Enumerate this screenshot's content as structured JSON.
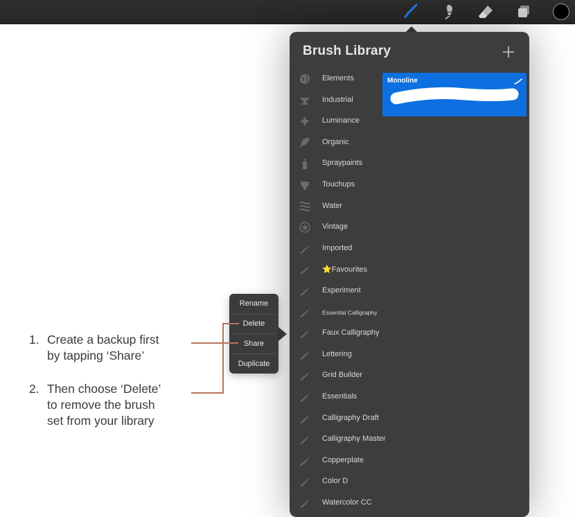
{
  "toolbar": {
    "tools": [
      "brush-icon",
      "smudge-icon",
      "eraser-icon",
      "layers-icon"
    ],
    "active_tool": "brush-icon",
    "active_color": "#000000",
    "accent": "#1f7ef0"
  },
  "brush_library": {
    "title": "Brush Library",
    "add_icon": "plus-icon",
    "sets": [
      {
        "label": "Elements",
        "icon": "globe-icon"
      },
      {
        "label": "Industrial",
        "icon": "anvil-icon"
      },
      {
        "label": "Luminance",
        "icon": "sparkle-icon"
      },
      {
        "label": "Organic",
        "icon": "leaf-icon"
      },
      {
        "label": "Spraypaints",
        "icon": "spraycan-icon"
      },
      {
        "label": "Touchups",
        "icon": "shell-icon"
      },
      {
        "label": "Water",
        "icon": "waves-icon"
      },
      {
        "label": "Vintage",
        "icon": "star-badge-icon"
      },
      {
        "label": "Imported",
        "icon": "brush-stroke-icon"
      },
      {
        "label": "⭐️Favourites",
        "icon": "brush-stroke-icon"
      },
      {
        "label": "Experiment",
        "icon": "brush-stroke-icon"
      },
      {
        "label": "Essential Calligraphy",
        "icon": "brush-stroke-icon"
      },
      {
        "label": "Faux Calligraphy",
        "icon": "brush-stroke-icon"
      },
      {
        "label": "Lettering",
        "icon": "brush-stroke-icon"
      },
      {
        "label": "Grid Builder",
        "icon": "brush-stroke-icon"
      },
      {
        "label": "Essentials",
        "icon": "brush-stroke-icon"
      },
      {
        "label": "Calligraphy Draft",
        "icon": "brush-stroke-icon"
      },
      {
        "label": "Calligraphy Master",
        "icon": "brush-stroke-icon"
      },
      {
        "label": "Copperplate",
        "icon": "brush-stroke-icon"
      },
      {
        "label": "Color D",
        "icon": "brush-stroke-icon"
      },
      {
        "label": "Watercolor CC",
        "icon": "brush-stroke-icon"
      }
    ],
    "selected_brush": {
      "name": "Monoline",
      "color": "#0d6fe0"
    }
  },
  "context_menu": {
    "items": [
      "Rename",
      "Delete",
      "Share",
      "Duplicate"
    ]
  },
  "instructions": [
    {
      "num": "1.",
      "lines": [
        "Create a backup first",
        "by tapping ‘Share’"
      ]
    },
    {
      "num": "2.",
      "lines": [
        "Then choose ‘Delete’",
        "to remove the brush",
        "set from your library"
      ]
    }
  ],
  "callout_color": "#b7735d"
}
